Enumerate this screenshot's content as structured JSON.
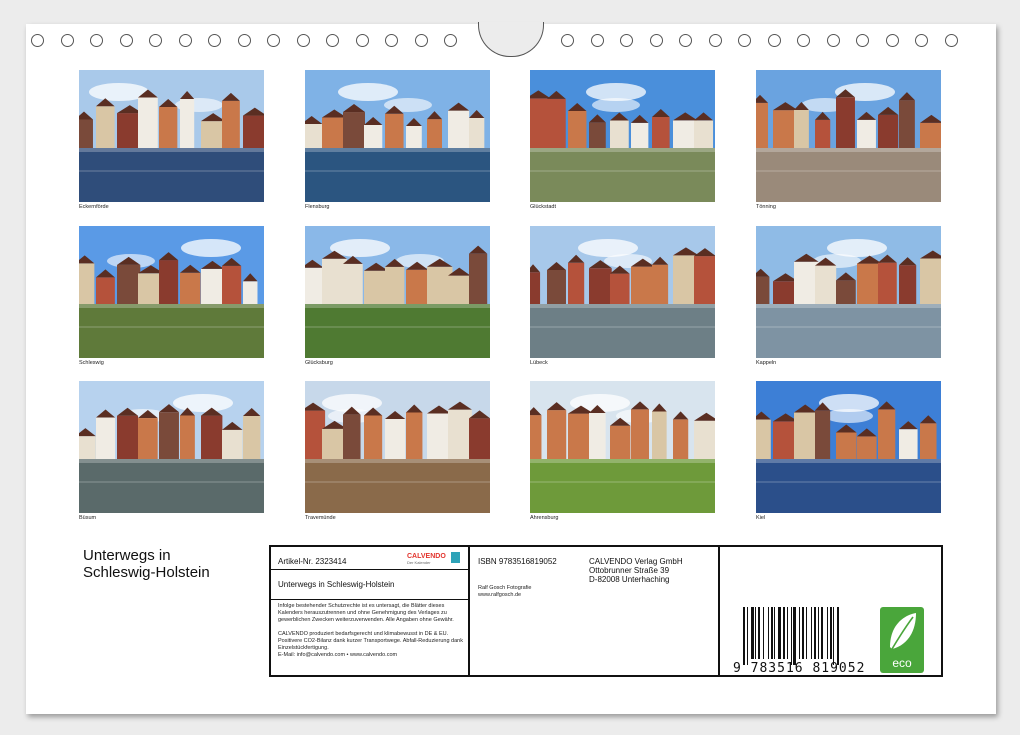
{
  "photos": [
    {
      "caption": "Eckernförde",
      "sky": "#a9c9ea",
      "ground": "#2f4d7a"
    },
    {
      "caption": "Flensburg",
      "sky": "#7fb2e6",
      "ground": "#2b5580"
    },
    {
      "caption": "Glückstadt",
      "sky": "#4a8fdb",
      "ground": "#7a8a5a"
    },
    {
      "caption": "Tönning",
      "sky": "#6aa3e0",
      "ground": "#9a8a7a"
    },
    {
      "caption": "Schleswig",
      "sky": "#5a9ae6",
      "ground": "#5f7a3a"
    },
    {
      "caption": "Glücksburg",
      "sky": "#8ab8e8",
      "ground": "#4f7a32"
    },
    {
      "caption": "Lübeck",
      "sky": "#a7c8ea",
      "ground": "#6d7f86"
    },
    {
      "caption": "Kappeln",
      "sky": "#8fbbe6",
      "ground": "#7e93a3"
    },
    {
      "caption": "Büsum",
      "sky": "#b7d2ee",
      "ground": "#5a6a6a"
    },
    {
      "caption": "Travemünde",
      "sky": "#c7d8ea",
      "ground": "#8a6a4a"
    },
    {
      "caption": "Ahrensburg",
      "sky": "#d8e4ee",
      "ground": "#6e9a3a"
    },
    {
      "caption": "Kiel",
      "sky": "#3d7fd6",
      "ground": "#2b4f8a"
    }
  ],
  "title_line1": "Unterwegs in",
  "title_line2": "Schleswig-Holstein",
  "info": {
    "article_label": "Artikel-Nr. 2323414",
    "logo": "CALVENDO",
    "logo_sub": "Der Kalender",
    "calendar_title": "Unterwegs in Schleswig-Holstein",
    "legal_text": "Infolge bestehender Schutzrechte ist es untersagt, die Blätter dieses Kalenders herauszutrennen und ohne Genehmigung des Verlages zu gewerblichen Zwecken weiterzuverwenden. Alle Angaben ohne Gewähr.",
    "legal_text2": "CALVENDO produziert bedarfsgerecht und klimabewusst in DE & EU. Positivere CO2-Bilanz dank kurzer Transportwege. Abfall-Reduzierung dank Einzelstückfertigung.",
    "contact": "E-Mail: info@calvendo.com • www.calvendo.com",
    "isbn": "ISBN 9783516819052",
    "photographer": "Ralf Gosch Fotografie",
    "website": "www.ralfgosch.de",
    "publisher": "CALVENDO Verlag GmbH",
    "street": "Ottobrunner Straße 39",
    "city": "D-82008 Unterhaching",
    "barcode_digits": "9 783516 819052",
    "eco_label": "eco"
  },
  "colors": {
    "eco_green": "#4aa63b",
    "calvendo_red": "#e2342d",
    "calvendo_teal": "#2ea3b8"
  }
}
